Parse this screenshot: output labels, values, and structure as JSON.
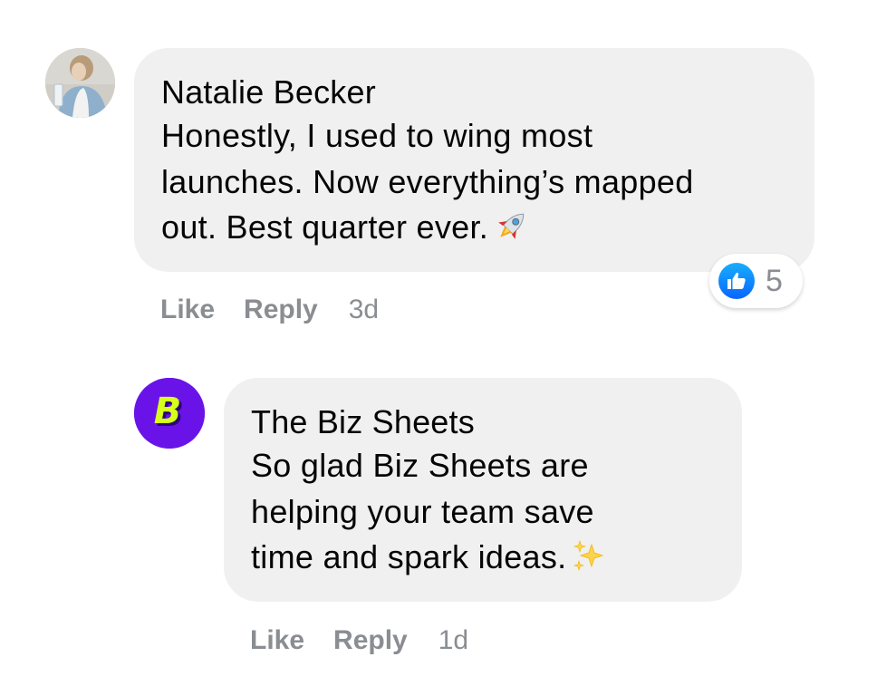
{
  "comments": [
    {
      "author": "Natalie Becker",
      "lines": [
        "Honestly, I used to wing most",
        "launches. Now everything’s mapped",
        "out. Best quarter ever."
      ],
      "emoji": "rocket-icon",
      "reaction_count": "5",
      "actions": {
        "like": "Like",
        "reply": "Reply",
        "time": "3d"
      }
    },
    {
      "author": "The Biz Sheets",
      "lines": [
        "So glad Biz Sheets are",
        "helping your team save",
        "time and spark ideas."
      ],
      "emoji": "sparkles-icon",
      "actions": {
        "like": "Like",
        "reply": "Reply",
        "time": "1d"
      }
    }
  ],
  "avatars": {
    "biz_logo_letter": "B",
    "biz_logo_color": "#6a13e8",
    "biz_letter_color": "#d7ff1e"
  },
  "colors": {
    "bubble": "#f0f0f0",
    "meta_text": "#8a8d91",
    "like_blue": "#0866ff"
  }
}
